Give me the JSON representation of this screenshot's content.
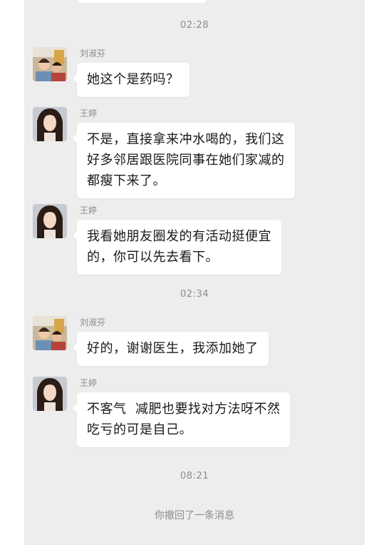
{
  "timestamps": [
    "02:28",
    "02:34",
    "08:21"
  ],
  "messages": [
    {
      "sender": "刘淑芬",
      "avatar": "avatar-liu",
      "lines": [
        "她这个是药吗？"
      ]
    },
    {
      "sender": "王婷",
      "avatar": "avatar-wang",
      "lines": [
        "不是，直接拿来冲水喝的，我们这",
        "好多邻居跟医院同事在她们家减的",
        "都瘦下来了。"
      ]
    },
    {
      "sender": "王婷",
      "avatar": "avatar-wang",
      "lines": [
        "我看她朋友圈发的有活动挺便宜",
        "的，你可以先去看下。"
      ]
    },
    {
      "sender": "刘淑芬",
      "avatar": "avatar-liu",
      "lines": [
        "好的，谢谢医生，我添加她了"
      ]
    },
    {
      "sender": "王婷",
      "avatar": "avatar-wang",
      "lines": [
        "不客气  减肥也要找对方法呀不然",
        "吃亏的可是自己。"
      ]
    }
  ],
  "system_notice": "你撤回了一条消息",
  "colors": {
    "chat_background": "#ededed",
    "bubble": "#ffffff",
    "meta_text": "#8c8c8c"
  }
}
